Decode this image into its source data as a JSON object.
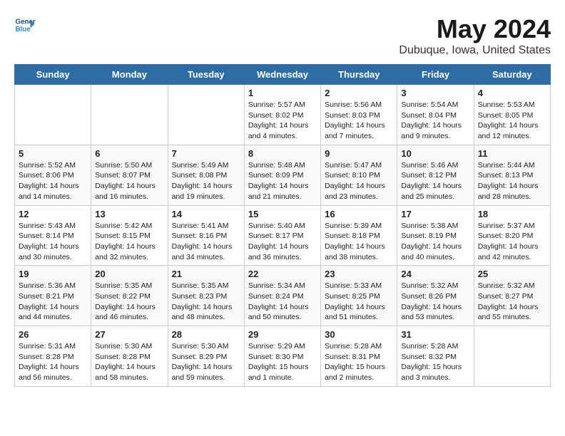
{
  "header": {
    "logo_line1": "General",
    "logo_line2": "Blue",
    "main_title": "May 2024",
    "subtitle": "Dubuque, Iowa, United States"
  },
  "weekdays": [
    "Sunday",
    "Monday",
    "Tuesday",
    "Wednesday",
    "Thursday",
    "Friday",
    "Saturday"
  ],
  "weeks": [
    [
      {
        "day": "",
        "info": ""
      },
      {
        "day": "",
        "info": ""
      },
      {
        "day": "",
        "info": ""
      },
      {
        "day": "1",
        "info": "Sunrise: 5:57 AM\nSunset: 8:02 PM\nDaylight: 14 hours\nand 4 minutes."
      },
      {
        "day": "2",
        "info": "Sunrise: 5:56 AM\nSunset: 8:03 PM\nDaylight: 14 hours\nand 7 minutes."
      },
      {
        "day": "3",
        "info": "Sunrise: 5:54 AM\nSunset: 8:04 PM\nDaylight: 14 hours\nand 9 minutes."
      },
      {
        "day": "4",
        "info": "Sunrise: 5:53 AM\nSunset: 8:05 PM\nDaylight: 14 hours\nand 12 minutes."
      }
    ],
    [
      {
        "day": "5",
        "info": "Sunrise: 5:52 AM\nSunset: 8:06 PM\nDaylight: 14 hours\nand 14 minutes."
      },
      {
        "day": "6",
        "info": "Sunrise: 5:50 AM\nSunset: 8:07 PM\nDaylight: 14 hours\nand 16 minutes."
      },
      {
        "day": "7",
        "info": "Sunrise: 5:49 AM\nSunset: 8:08 PM\nDaylight: 14 hours\nand 19 minutes."
      },
      {
        "day": "8",
        "info": "Sunrise: 5:48 AM\nSunset: 8:09 PM\nDaylight: 14 hours\nand 21 minutes."
      },
      {
        "day": "9",
        "info": "Sunrise: 5:47 AM\nSunset: 8:10 PM\nDaylight: 14 hours\nand 23 minutes."
      },
      {
        "day": "10",
        "info": "Sunrise: 5:46 AM\nSunset: 8:12 PM\nDaylight: 14 hours\nand 25 minutes."
      },
      {
        "day": "11",
        "info": "Sunrise: 5:44 AM\nSunset: 8:13 PM\nDaylight: 14 hours\nand 28 minutes."
      }
    ],
    [
      {
        "day": "12",
        "info": "Sunrise: 5:43 AM\nSunset: 8:14 PM\nDaylight: 14 hours\nand 30 minutes."
      },
      {
        "day": "13",
        "info": "Sunrise: 5:42 AM\nSunset: 8:15 PM\nDaylight: 14 hours\nand 32 minutes."
      },
      {
        "day": "14",
        "info": "Sunrise: 5:41 AM\nSunset: 8:16 PM\nDaylight: 14 hours\nand 34 minutes."
      },
      {
        "day": "15",
        "info": "Sunrise: 5:40 AM\nSunset: 8:17 PM\nDaylight: 14 hours\nand 36 minutes."
      },
      {
        "day": "16",
        "info": "Sunrise: 5:39 AM\nSunset: 8:18 PM\nDaylight: 14 hours\nand 38 minutes."
      },
      {
        "day": "17",
        "info": "Sunrise: 5:38 AM\nSunset: 8:19 PM\nDaylight: 14 hours\nand 40 minutes."
      },
      {
        "day": "18",
        "info": "Sunrise: 5:37 AM\nSunset: 8:20 PM\nDaylight: 14 hours\nand 42 minutes."
      }
    ],
    [
      {
        "day": "19",
        "info": "Sunrise: 5:36 AM\nSunset: 8:21 PM\nDaylight: 14 hours\nand 44 minutes."
      },
      {
        "day": "20",
        "info": "Sunrise: 5:35 AM\nSunset: 8:22 PM\nDaylight: 14 hours\nand 46 minutes."
      },
      {
        "day": "21",
        "info": "Sunrise: 5:35 AM\nSunset: 8:23 PM\nDaylight: 14 hours\nand 48 minutes."
      },
      {
        "day": "22",
        "info": "Sunrise: 5:34 AM\nSunset: 8:24 PM\nDaylight: 14 hours\nand 50 minutes."
      },
      {
        "day": "23",
        "info": "Sunrise: 5:33 AM\nSunset: 8:25 PM\nDaylight: 14 hours\nand 51 minutes."
      },
      {
        "day": "24",
        "info": "Sunrise: 5:32 AM\nSunset: 8:26 PM\nDaylight: 14 hours\nand 53 minutes."
      },
      {
        "day": "25",
        "info": "Sunrise: 5:32 AM\nSunset: 8:27 PM\nDaylight: 14 hours\nand 55 minutes."
      }
    ],
    [
      {
        "day": "26",
        "info": "Sunrise: 5:31 AM\nSunset: 8:28 PM\nDaylight: 14 hours\nand 56 minutes."
      },
      {
        "day": "27",
        "info": "Sunrise: 5:30 AM\nSunset: 8:28 PM\nDaylight: 14 hours\nand 58 minutes."
      },
      {
        "day": "28",
        "info": "Sunrise: 5:30 AM\nSunset: 8:29 PM\nDaylight: 14 hours\nand 59 minutes."
      },
      {
        "day": "29",
        "info": "Sunrise: 5:29 AM\nSunset: 8:30 PM\nDaylight: 15 hours\nand 1 minute."
      },
      {
        "day": "30",
        "info": "Sunrise: 5:28 AM\nSunset: 8:31 PM\nDaylight: 15 hours\nand 2 minutes."
      },
      {
        "day": "31",
        "info": "Sunrise: 5:28 AM\nSunset: 8:32 PM\nDaylight: 15 hours\nand 3 minutes."
      },
      {
        "day": "",
        "info": ""
      }
    ]
  ]
}
